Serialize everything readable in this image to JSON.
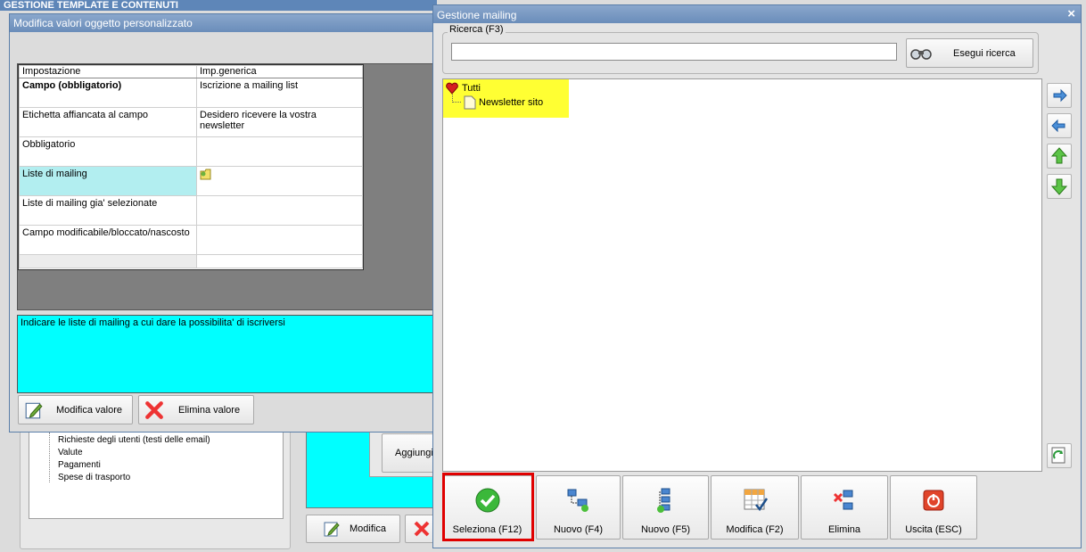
{
  "background_window": {
    "title": "GESTIONE TEMPLATE E CONTENUTI",
    "tree_items": [
      "Richieste degli utenti (testi delle email)",
      "Valute",
      "Pagamenti",
      "Spese di trasporto"
    ],
    "aggiungi_label": "Aggiungi",
    "modifica_label": "Modifica"
  },
  "edit_dialog": {
    "title": "Modifica valori oggetto personalizzato",
    "columns": [
      "Impostazione",
      "Imp.generica"
    ],
    "rows": [
      {
        "setting": "Campo (obbligatorio)",
        "value": "Iscrizione a mailing list"
      },
      {
        "setting": "Etichetta affiancata al campo",
        "value": "Desidero ricevere la vostra newsletter"
      },
      {
        "setting": "Obbligatorio",
        "value": ""
      },
      {
        "setting": "Liste di mailing",
        "value": ""
      },
      {
        "setting": "Liste di mailing gia' selezionate",
        "value": ""
      },
      {
        "setting": "Campo modificabile/bloccato/nascosto",
        "value": ""
      },
      {
        "setting": "",
        "value": ""
      }
    ],
    "description": "Indicare le liste di mailing a cui dare la possibilita' di iscriversi",
    "modifica_valore_label": "Modifica valore",
    "elimina_valore_label": "Elimina valore"
  },
  "mailing_dialog": {
    "title": "Gestione mailing",
    "close_glyph": "×",
    "search_group_label": "Ricerca (F3)",
    "search_value": "",
    "search_button_label": "Esegui ricerca",
    "tree_root": "Tutti",
    "tree_child": "Newsletter sito",
    "toolbar": [
      {
        "label": "Seleziona (F12)",
        "icon": "check-icon"
      },
      {
        "label": "Nuovo (F4)",
        "icon": "new-node-icon"
      },
      {
        "label": "Nuovo (F5)",
        "icon": "new-child-icon"
      },
      {
        "label": "Modifica (F2)",
        "icon": "edit-table-icon"
      },
      {
        "label": "Elimina",
        "icon": "delete-node-icon"
      },
      {
        "label": "Uscita (ESC)",
        "icon": "exit-icon"
      }
    ]
  },
  "colors": {
    "title_bar": "#6c8fb9",
    "selected_row": "#b2eef0",
    "description_bg": "#00ffff",
    "tree_highlight": "#ffff33",
    "selection_outline": "#e00000"
  }
}
